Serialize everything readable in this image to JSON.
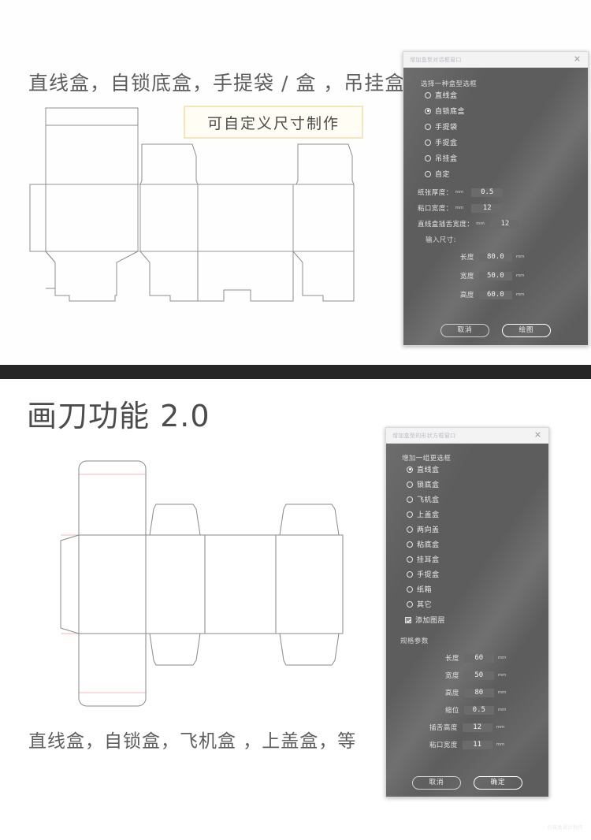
{
  "section_top": {
    "headline": "直线盒，自锁底盒，手提袋 / 盒 ，吊挂盒",
    "badge": "可自定义尺寸制作"
  },
  "section_bottom": {
    "headline": "画刀功能 2.0",
    "caption": "直线盒，自锁盒，飞机盒 ，上盖盒，等",
    "watermark": "包装盒设计制作"
  },
  "dialog1": {
    "title": "增加盒型对话框窗口",
    "close_icon": "close-icon",
    "group_label": "选择一种盒型选框",
    "options": [
      {
        "label": "直线盒",
        "selected": false
      },
      {
        "label": "自锁底盒",
        "selected": true
      },
      {
        "label": "手提袋",
        "selected": false
      },
      {
        "label": "手提盒",
        "selected": false
      },
      {
        "label": "吊挂盒",
        "selected": false
      },
      {
        "label": "自定",
        "selected": false
      }
    ],
    "params": [
      {
        "label": "纸张厚度：",
        "unit": "mm",
        "value": "0.5"
      },
      {
        "label": "粘口宽度：",
        "unit": "mm",
        "value": "12"
      },
      {
        "label": "直线盒插舌宽度：",
        "unit": "mm",
        "value": "12"
      }
    ],
    "size_label": "输入尺寸:",
    "sizes": [
      {
        "label": "长度",
        "value": "80.0",
        "unit": "mm"
      },
      {
        "label": "宽度",
        "value": "50.0",
        "unit": "mm"
      },
      {
        "label": "高度",
        "value": "60.0",
        "unit": "mm"
      }
    ],
    "cancel_label": "取消",
    "confirm_label": "绘图"
  },
  "dialog2": {
    "title": "增加盒型的形状方框窗口",
    "close_icon": "close-icon",
    "group_label": "增加一组更选框",
    "options": [
      {
        "label": "直线盒",
        "selected": true
      },
      {
        "label": "锁底盒",
        "selected": false
      },
      {
        "label": "飞机盒",
        "selected": false
      },
      {
        "label": "上盖盒",
        "selected": false
      },
      {
        "label": "两向盖",
        "selected": false
      },
      {
        "label": "粘底盒",
        "selected": false
      },
      {
        "label": "挂耳盒",
        "selected": false
      },
      {
        "label": "手提盒",
        "selected": false
      },
      {
        "label": "纸箱",
        "selected": false
      },
      {
        "label": "其它",
        "selected": false
      }
    ],
    "checkbox": {
      "label": "添加图层",
      "checked": true
    },
    "spec_label": "规格参数",
    "specs": [
      {
        "label": "长度",
        "value": "60",
        "unit": "mm"
      },
      {
        "label": "宽度",
        "value": "50",
        "unit": "mm"
      },
      {
        "label": "高度",
        "value": "80",
        "unit": "mm"
      },
      {
        "label": "缩位",
        "value": "0.5",
        "unit": "mm"
      },
      {
        "label": "插舌高度",
        "value": "12",
        "unit": "mm"
      },
      {
        "label": "粘口宽度",
        "value": "11",
        "unit": "mm"
      }
    ],
    "cancel_label": "取消",
    "confirm_label": "确定"
  },
  "colors": {
    "dialog_bg": "#5d5d5d",
    "divider": "#262626",
    "badge_border": "#f4e6b8",
    "dieline_stroke": "#8a8a8a",
    "crease_red": "#f3b6bb"
  }
}
